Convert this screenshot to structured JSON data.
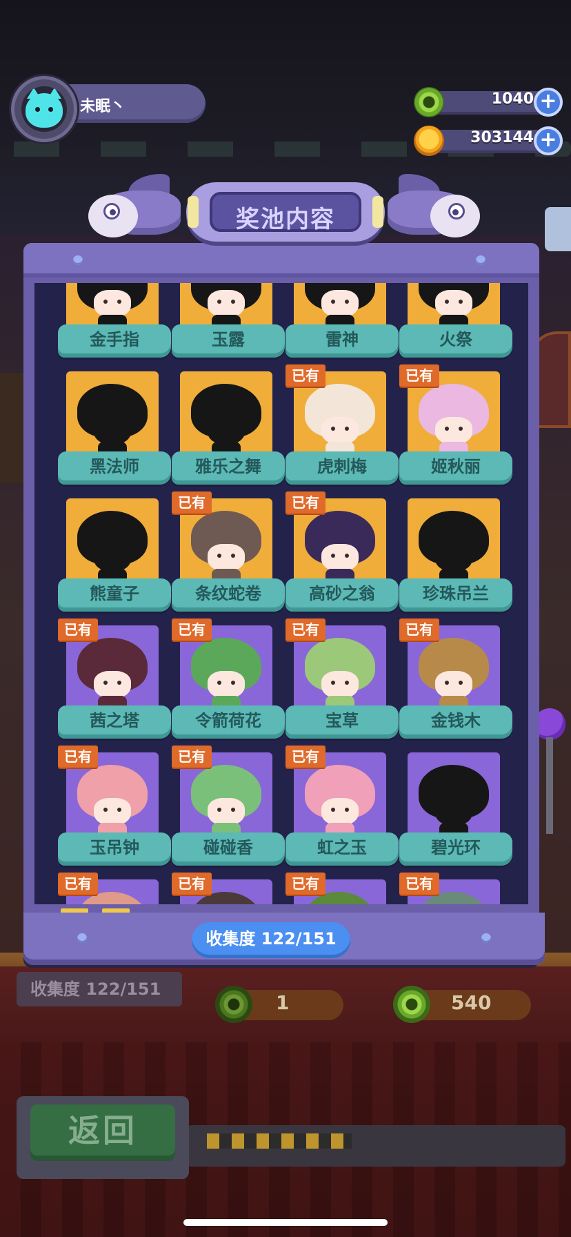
{
  "player": {
    "name": "未眠丶"
  },
  "currencies": [
    {
      "icon": "green-coin-icon",
      "value": "1040"
    },
    {
      "icon": "orange-planet-coin-icon",
      "value": "303144"
    }
  ],
  "modal": {
    "title": "奖池内容",
    "owned_label": "已有",
    "collection_label": "收集度  122/151",
    "items": [
      {
        "name": "金手指",
        "owned": false,
        "bg": "gold"
      },
      {
        "name": "玉露",
        "owned": false,
        "bg": "gold"
      },
      {
        "name": "雷神",
        "owned": false,
        "bg": "gold"
      },
      {
        "name": "火祭",
        "owned": false,
        "bg": "gold"
      },
      {
        "name": "黑法师",
        "owned": false,
        "bg": "gold",
        "silhouette": true
      },
      {
        "name": "雅乐之舞",
        "owned": false,
        "bg": "gold",
        "silhouette": true
      },
      {
        "name": "虎刺梅",
        "owned": true,
        "bg": "gold",
        "hair": "#f3e6d8"
      },
      {
        "name": "姬秋丽",
        "owned": true,
        "bg": "gold",
        "hair": "#eab8e0"
      },
      {
        "name": "熊童子",
        "owned": false,
        "bg": "gold",
        "silhouette": true
      },
      {
        "name": "条纹蛇卷",
        "owned": true,
        "bg": "gold",
        "hair": "#6e5a52"
      },
      {
        "name": "高砂之翁",
        "owned": true,
        "bg": "gold",
        "hair": "#3a2a5a"
      },
      {
        "name": "珍珠吊兰",
        "owned": false,
        "bg": "gold",
        "silhouette": true
      },
      {
        "name": "茜之塔",
        "owned": true,
        "bg": "purple",
        "hair": "#5a2a3a"
      },
      {
        "name": "令箭荷花",
        "owned": true,
        "bg": "purple",
        "hair": "#5ba85a"
      },
      {
        "name": "宝草",
        "owned": true,
        "bg": "purple",
        "hair": "#9cc87a"
      },
      {
        "name": "金钱木",
        "owned": true,
        "bg": "purple",
        "hair": "#b88a4a"
      },
      {
        "name": "玉吊钟",
        "owned": true,
        "bg": "purple",
        "hair": "#f0a0a8"
      },
      {
        "name": "碰碰香",
        "owned": true,
        "bg": "purple",
        "hair": "#7ac07a"
      },
      {
        "name": "虹之玉",
        "owned": true,
        "bg": "purple",
        "hair": "#f0a0b8"
      },
      {
        "name": "碧光环",
        "owned": false,
        "bg": "purple",
        "silhouette": true
      },
      {
        "name": "",
        "owned": true,
        "bg": "purple",
        "hair": "#e09a8a"
      },
      {
        "name": "",
        "owned": true,
        "bg": "purple",
        "hair": "#4a3a3a"
      },
      {
        "name": "",
        "owned": true,
        "bg": "purple",
        "hair": "#5a8a3a"
      },
      {
        "name": "",
        "owned": true,
        "bg": "purple",
        "hair": "#6a8a7a"
      }
    ]
  },
  "background": {
    "collection_label": "收集度  122/151",
    "single_cost": "1",
    "multi_cost": "540",
    "back_label": "返回"
  },
  "colors": {
    "owned_badge": "#e06a2a",
    "label_teal": "#5cb9b5",
    "tile_gold": "#f0ad3a",
    "tile_purple": "#8a67d8",
    "collect_blue": "#4b8ff0"
  }
}
